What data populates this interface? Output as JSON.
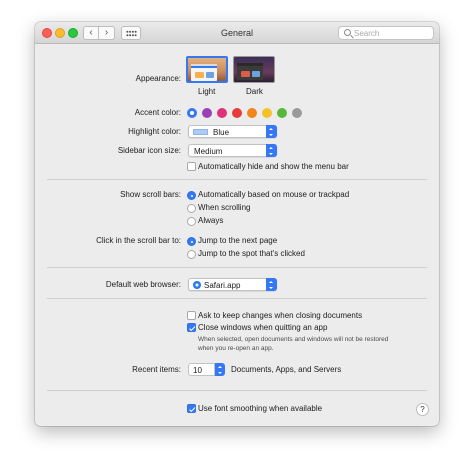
{
  "window": {
    "title": "General"
  },
  "toolbar": {
    "back_glyph": "‹",
    "forward_glyph": "›",
    "search_placeholder": "Search"
  },
  "appearance": {
    "label": "Appearance:",
    "options": [
      {
        "label": "Light",
        "selected": true
      },
      {
        "label": "Dark",
        "selected": false
      }
    ]
  },
  "accent": {
    "label": "Accent color:",
    "colors": [
      "#3478f6",
      "#9b3fb6",
      "#e0327a",
      "#e73b3b",
      "#f2851b",
      "#f5c12a",
      "#57b83a",
      "#9a9a9a"
    ],
    "selected_index": 0
  },
  "highlight": {
    "label": "Highlight color:",
    "value": "Blue",
    "swatch": "#aecbf6"
  },
  "sidebar_icon": {
    "label": "Sidebar icon size:",
    "value": "Medium"
  },
  "menubar_auto_hide": {
    "label": "Automatically hide and show the menu bar",
    "checked": false
  },
  "scroll_bars": {
    "label": "Show scroll bars:",
    "options": [
      {
        "label": "Automatically based on mouse or trackpad",
        "selected": true
      },
      {
        "label": "When scrolling",
        "selected": false
      },
      {
        "label": "Always",
        "selected": false
      }
    ]
  },
  "click_scroll": {
    "label": "Click in the scroll bar to:",
    "options": [
      {
        "label": "Jump to the next page",
        "selected": true
      },
      {
        "label": "Jump to the spot that's clicked",
        "selected": false
      }
    ]
  },
  "browser": {
    "label": "Default web browser:",
    "value": "Safari.app"
  },
  "documents": {
    "ask_keep": {
      "label": "Ask to keep changes when closing documents",
      "checked": false
    },
    "close_windows": {
      "label": "Close windows when quitting an app",
      "checked": true
    },
    "note": "When selected, open documents and windows will not be restored when you re-open an app."
  },
  "recent": {
    "label": "Recent items:",
    "value": "10",
    "suffix": "Documents, Apps, and Servers"
  },
  "font_smoothing": {
    "label": "Use font smoothing when available",
    "checked": true
  },
  "help": {
    "glyph": "?"
  }
}
